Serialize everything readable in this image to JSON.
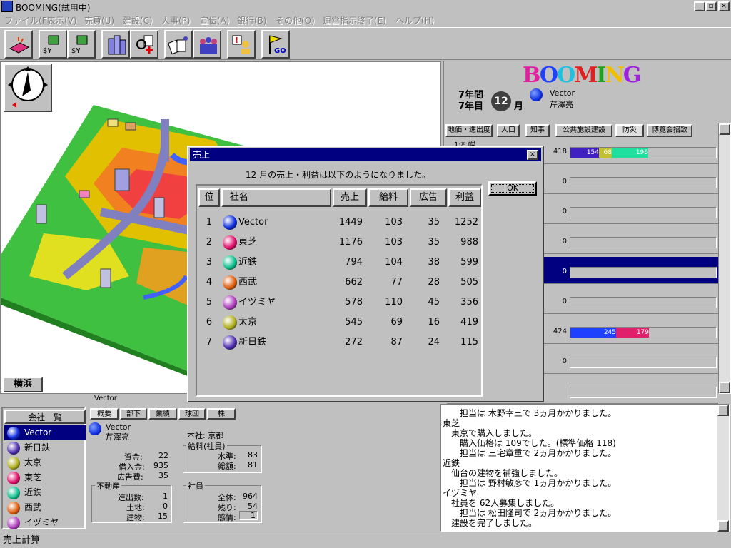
{
  "window": {
    "title": "BOOMING(試用中)"
  },
  "menu": [
    "ファイル(F)",
    "表示(V)",
    "売買(U)",
    "建設(C)",
    "人事(P)",
    "宣伝(A)",
    "銀行(B)",
    "その他(O)",
    "運営指示終了(E)",
    "ヘルプ(H)"
  ],
  "map": {
    "city_label": "横浜"
  },
  "panel": {
    "logo": "BOOMING",
    "years_label": "7年間",
    "year_label": "7年目",
    "month": "12",
    "month_suffix": "月",
    "company": "Vector",
    "president": "芹澤亮",
    "tabs": [
      "地価・進出度",
      "人口",
      "知事",
      "公共施設建設",
      "防災",
      "博覧会招致"
    ],
    "first_row_label": "1:札幌",
    "rows": [
      {
        "total": "418",
        "seg1": "154",
        "seg2": "68",
        "seg3": "196",
        "seg_vals": [
          154,
          68,
          196
        ],
        "colors": [
          "#4020c0",
          "#c0c030",
          "#20e0a0"
        ]
      },
      {
        "total": "0"
      },
      {
        "total": "0"
      },
      {
        "total": "0"
      },
      {
        "total": "0",
        "selected": true
      },
      {
        "total": "0"
      },
      {
        "total": "424",
        "seg1": "245",
        "seg2": "179",
        "seg_vals": [
          245,
          179
        ],
        "colors": [
          "#2040ff",
          "#e0206a"
        ]
      },
      {
        "total": "0"
      },
      {
        "total": ""
      }
    ]
  },
  "dialog": {
    "title": "売上",
    "close": "×",
    "message": "12 月の売上・利益は以下のようになりました。",
    "ok_label": "OK",
    "headers": [
      "位",
      "社名",
      "売上",
      "給料",
      "広告",
      "利益"
    ],
    "rows": [
      {
        "rank": "1",
        "name": "Vector",
        "sales": "1449",
        "salary": "103",
        "ad": "35",
        "profit": "1252",
        "color": "#1030e0"
      },
      {
        "rank": "2",
        "name": "東芝",
        "sales": "1176",
        "salary": "103",
        "ad": "35",
        "profit": "988",
        "color": "#e0106a"
      },
      {
        "rank": "3",
        "name": "近鉄",
        "sales": "794",
        "salary": "104",
        "ad": "38",
        "profit": "599",
        "color": "#10c090"
      },
      {
        "rank": "4",
        "name": "西武",
        "sales": "662",
        "salary": "77",
        "ad": "28",
        "profit": "505",
        "color": "#e06010"
      },
      {
        "rank": "5",
        "name": "イヅミヤ",
        "sales": "578",
        "salary": "110",
        "ad": "45",
        "profit": "356",
        "color": "#b040c0"
      },
      {
        "rank": "6",
        "name": "太京",
        "sales": "545",
        "salary": "69",
        "ad": "16",
        "profit": "419",
        "color": "#b0b020"
      },
      {
        "rank": "7",
        "name": "新日鉄",
        "sales": "272",
        "salary": "87",
        "ad": "24",
        "profit": "115",
        "color": "#5030b0"
      }
    ]
  },
  "bottom": {
    "header_company": "Vector",
    "list_title": "会社一覧",
    "companies": [
      {
        "name": "Vector",
        "color": "#1030e0",
        "selected": true
      },
      {
        "name": "新日鉄",
        "color": "#5030b0"
      },
      {
        "name": "太京",
        "color": "#b0b020"
      },
      {
        "name": "東芝",
        "color": "#e0106a"
      },
      {
        "name": "近鉄",
        "color": "#10c090"
      },
      {
        "name": "西武",
        "color": "#e06010"
      },
      {
        "name": "イヅミヤ",
        "color": "#b040c0"
      }
    ],
    "tabs": [
      "概要",
      "部下",
      "業績",
      "球団",
      "株"
    ],
    "company": "Vector",
    "president": "芹澤亮",
    "hq": "本社: 京都",
    "capital_label": "資金:",
    "capital": "22",
    "debt_label": "借入金:",
    "debt": "935",
    "ad_label": "広告費:",
    "ad": "35",
    "salary_title": "給料(社員)",
    "level_label": "水準:",
    "level": "83",
    "total_label": "総額:",
    "total": "81",
    "realty_title": "不動産",
    "stores_label": "進出数:",
    "stores": "1",
    "land_label": "土地:",
    "land": "0",
    "buildings_label": "建物:",
    "buildings": "15",
    "staff_title": "社員",
    "all_label": "全体:",
    "all": "964",
    "rest_label": "残り:",
    "rest": "54",
    "feel_label": "感情:",
    "feel": "1"
  },
  "log": [
    "担当は 木野幸三で 3ヵ月かかりました。",
    "東芝",
    "東京で購入しました。",
    "購入価格は 109でした。(標準価格 118)",
    "担当は 三宅章重で 2ヵ月かかりました。",
    "近鉄",
    "仙台の建物を補強しました。",
    "担当は 野村敏彦で 1ヵ月かかりました。",
    "イヅミヤ",
    "社員を 62人募集しました。",
    "担当は 松田隆司で 2ヵ月かかりました。",
    "建設を完了しました。"
  ],
  "status": "売上計算"
}
